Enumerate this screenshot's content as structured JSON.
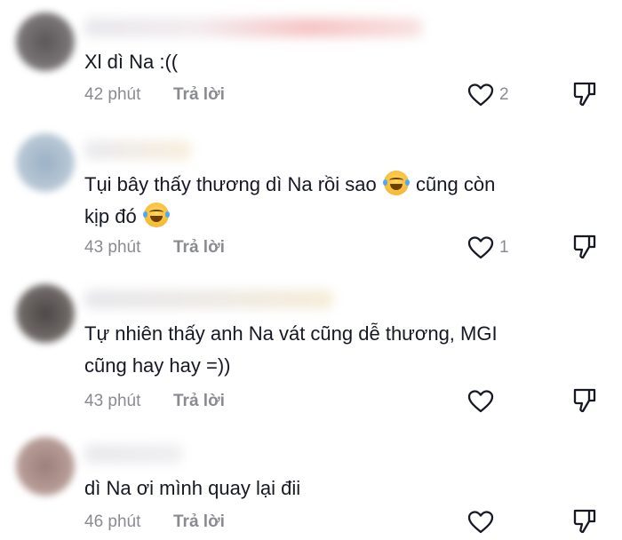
{
  "comments": [
    {
      "text": "Xl dì Na :((",
      "time": "42 phút",
      "reply_label": "Trả lời",
      "likes": "2"
    },
    {
      "text_line1": "Tụi bây thấy thương dì Na rồi sao",
      "text_line1_tail": "cũng còn",
      "text_line2": "kịp đó",
      "time": "43 phút",
      "reply_label": "Trả lời",
      "likes": "1"
    },
    {
      "text_line1": "Tự nhiên thấy anh Na vát cũng dễ thương, MGI",
      "text_line2": "cũng hay hay =))",
      "time": "43 phút",
      "reply_label": "Trả lời",
      "likes": ""
    },
    {
      "text": "dì Na ơi mình quay lại đii",
      "time": "46 phút",
      "reply_label": "Trả lời",
      "likes": ""
    }
  ],
  "icons": {
    "like": "heart-outline-icon",
    "dislike": "thumbs-down-icon",
    "emoji": "face-with-tears-of-joy"
  },
  "colors": {
    "text": "#161823",
    "meta": "#8a8b91"
  }
}
